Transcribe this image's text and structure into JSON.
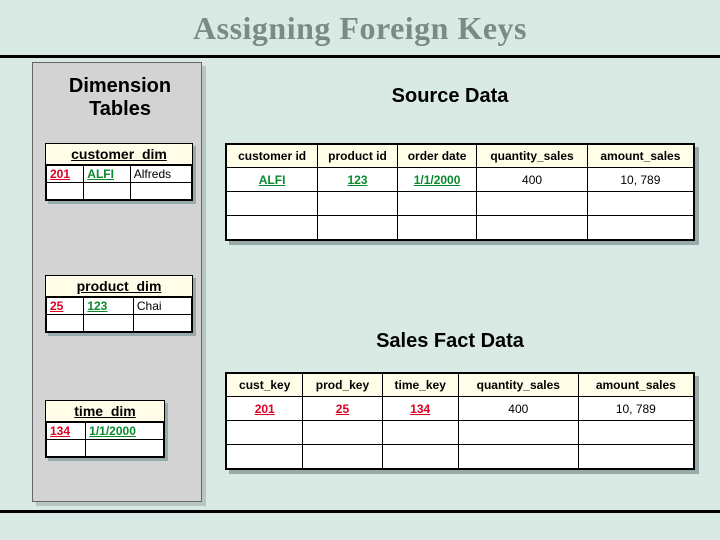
{
  "title": "Assigning Foreign Keys",
  "headings": {
    "dimension": "Dimension Tables",
    "source": "Source Data",
    "fact": "Sales Fact Data"
  },
  "customer_dim": {
    "caption": "customer_dim",
    "rows": [
      {
        "key": "201",
        "code": "ALFI",
        "name": "Alfreds"
      }
    ]
  },
  "product_dim": {
    "caption": "product_dim",
    "rows": [
      {
        "key": "25",
        "code": "123",
        "name": "Chai"
      }
    ]
  },
  "time_dim": {
    "caption": "time_dim",
    "rows": [
      {
        "key": "134",
        "date": "1/1/2000"
      }
    ]
  },
  "source_table": {
    "headers": [
      "customer id",
      "product id",
      "order date",
      "quantity_sales",
      "amount_sales"
    ],
    "rows": [
      {
        "c0": "ALFI",
        "c1": "123",
        "c2": "1/1/2000",
        "c3": "400",
        "c4": "10, 789"
      }
    ]
  },
  "fact_table": {
    "headers": [
      "cust_key",
      "prod_key",
      "time_key",
      "quantity_sales",
      "amount_sales"
    ],
    "rows": [
      {
        "c0": "201",
        "c1": "25",
        "c2": "134",
        "c3": "400",
        "c4": "10, 789"
      }
    ]
  }
}
